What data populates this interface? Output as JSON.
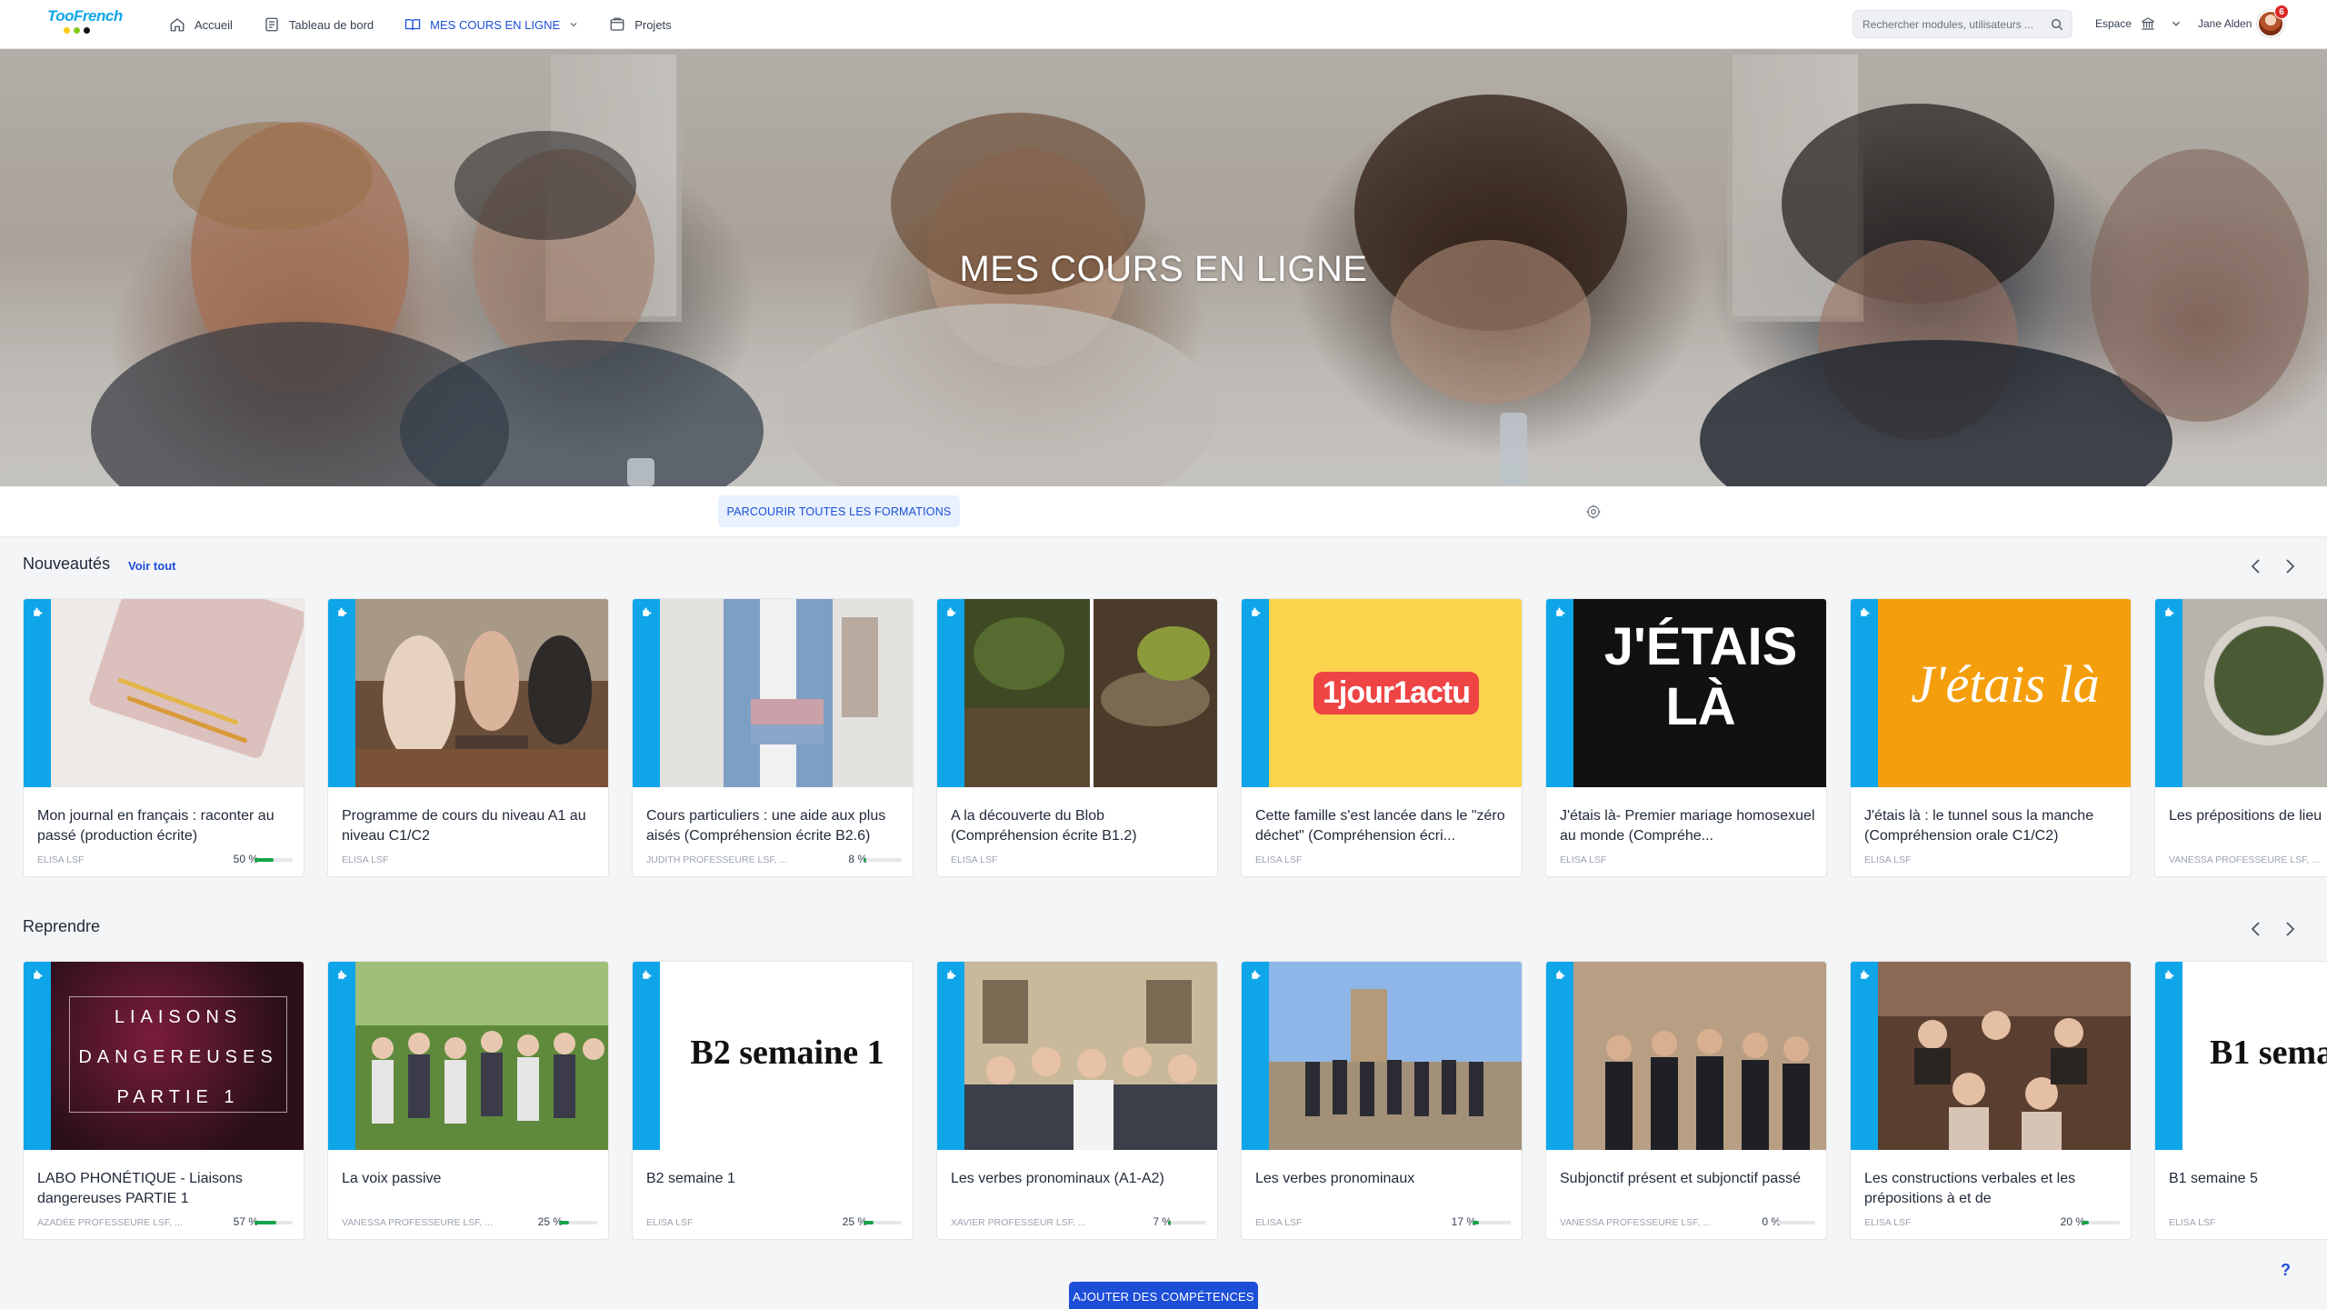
{
  "topbar": {
    "logo": "TooFrench",
    "nav": [
      {
        "label": "Accueil",
        "icon": "home-icon"
      },
      {
        "label": "Tableau de bord",
        "icon": "dashboard-icon"
      },
      {
        "label": "MES COURS EN LIGNE",
        "icon": "book-icon"
      },
      {
        "label": "Projets",
        "icon": "folder-icon"
      }
    ],
    "search_placeholder": "Rechercher modules, utilisateurs ...",
    "space_label": "Espace",
    "user_name": "Jane Alden",
    "notification_count": "6"
  },
  "hero": {
    "title": "MES COURS EN LIGNE"
  },
  "actions": {
    "browse_label": "PARCOURIR TOUTES LES FORMATIONS"
  },
  "sections": {
    "new": {
      "title": "Nouveautés",
      "see_all": "Voir tout"
    },
    "resume": {
      "title": "Reprendre"
    }
  },
  "new_courses": [
    {
      "title": "Mon journal en français : raconter au passé (production écrite)",
      "author": "ELISA LSF",
      "progress": "50 %",
      "progress_value": 50
    },
    {
      "title": "Programme de cours du niveau A1 au niveau C1/C2",
      "author": "ELISA LSF",
      "progress": "",
      "progress_value": 0
    },
    {
      "title": "Cours particuliers : une aide aux plus aisés (Compréhension écrite B2.6)",
      "author": "JUDITH PROFESSEURE LSF, ...",
      "progress": "8 %",
      "progress_value": 8
    },
    {
      "title": "A la découverte du Blob (Compréhension écrite B1.2)",
      "author": "ELISA LSF",
      "progress": "",
      "progress_value": 0
    },
    {
      "title": "Cette famille s'est lancée dans le \"zéro déchet\" (Compréhension écri...",
      "author": "ELISA LSF",
      "progress": "",
      "progress_value": 0,
      "image_text": "1jour1actu"
    },
    {
      "title": "J'étais là- Premier mariage homosexuel au monde (Compréhe...",
      "author": "ELISA LSF",
      "progress": "",
      "progress_value": 0,
      "image_text": "J'ÉTAIS LÀ"
    },
    {
      "title": "J'étais là : le tunnel sous la manche (Compréhension orale C1/C2)",
      "author": "ELISA LSF",
      "progress": "",
      "progress_value": 0,
      "image_text": "J'étais là"
    },
    {
      "title": "Les prépositions de lieu",
      "author": "VANESSA PROFESSEURE LSF, ...",
      "progress": "",
      "progress_value": 0
    }
  ],
  "resume_courses": [
    {
      "title": "LABO PHONÉTIQUE - Liaisons dangereuses PARTIE 1",
      "author": "AZADÉE PROFESSEURE LSF, ...",
      "progress": "57 %",
      "progress_value": 57,
      "image_lines": [
        "LIAISONS",
        "DANGEREUSES",
        "PARTIE 1"
      ]
    },
    {
      "title": "La voix passive",
      "author": "VANESSA PROFESSEURE LSF, ...",
      "progress": "25 %",
      "progress_value": 25
    },
    {
      "title": "B2 semaine 1",
      "author": "ELISA LSF",
      "progress": "25 %",
      "progress_value": 25,
      "image_text": "B2 semaine 1"
    },
    {
      "title": "Les verbes pronominaux (A1-A2)",
      "author": "XAVIER PROFESSEUR LSF, ...",
      "progress": "7 %",
      "progress_value": 7
    },
    {
      "title": "Les verbes pronominaux",
      "author": "ELISA LSF",
      "progress": "17 %",
      "progress_value": 17
    },
    {
      "title": "Subjonctif présent et subjonctif passé",
      "author": "VANESSA PROFESSEURE LSF, ...",
      "progress": "0 %",
      "progress_value": 0
    },
    {
      "title": "Les constructions verbales et les prépositions à et de",
      "author": "ELISA LSF",
      "progress": "20 %",
      "progress_value": 20
    },
    {
      "title": "B1 semaine 5",
      "author": "ELISA LSF",
      "progress": "",
      "progress_value": 0,
      "image_text": "B1 sema"
    }
  ],
  "footer": {
    "add_skills_label": "AJOUTER DES COMPÉTENCES",
    "help": "?"
  }
}
